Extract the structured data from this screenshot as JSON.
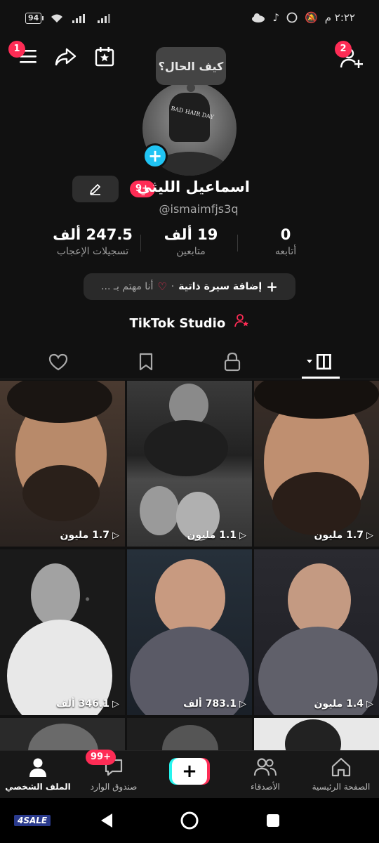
{
  "status_bar": {
    "battery": "94",
    "time": "٢:٢٢ م"
  },
  "top_bar": {
    "menu_badge": "1",
    "follow_badge": "2"
  },
  "profile": {
    "bubble_text": "كيف الحال؟",
    "avatar_hat_text": "BAD HAIR DAY",
    "name": "اسماعيل الليثي",
    "name_badge": "9+",
    "handle": "@ismaimfjs3q"
  },
  "stats": [
    {
      "num": "0",
      "label": "أتابعه"
    },
    {
      "num": "19 ألف",
      "label": "متابعين"
    },
    {
      "num": "247.5 ألف",
      "label": "تسجيلات الإعجاب"
    }
  ],
  "bio": {
    "add_bio": "إضافة سيرة ذاتية",
    "separator": "·",
    "interested": "أنا مهتم بـ ..."
  },
  "studio_label": "TikTok Studio",
  "videos": [
    {
      "views": "1.7 مليون"
    },
    {
      "views": "1.1 مليون"
    },
    {
      "views": "1.7 مليون"
    },
    {
      "views": "346.1 ألف"
    },
    {
      "views": "783.1 ألف"
    },
    {
      "views": "1.4 مليون"
    }
  ],
  "bottom_nav": {
    "home": "الصفحة الرئيسية",
    "friends": "الأصدقاء",
    "inbox": "صندوق الوارد",
    "inbox_badge": "99+",
    "profile": "الملف الشخصي"
  },
  "watermark": "4SALE",
  "colors": {
    "accent": "#fe2c55",
    "cyan": "#25f4ee",
    "background": "#111111"
  }
}
